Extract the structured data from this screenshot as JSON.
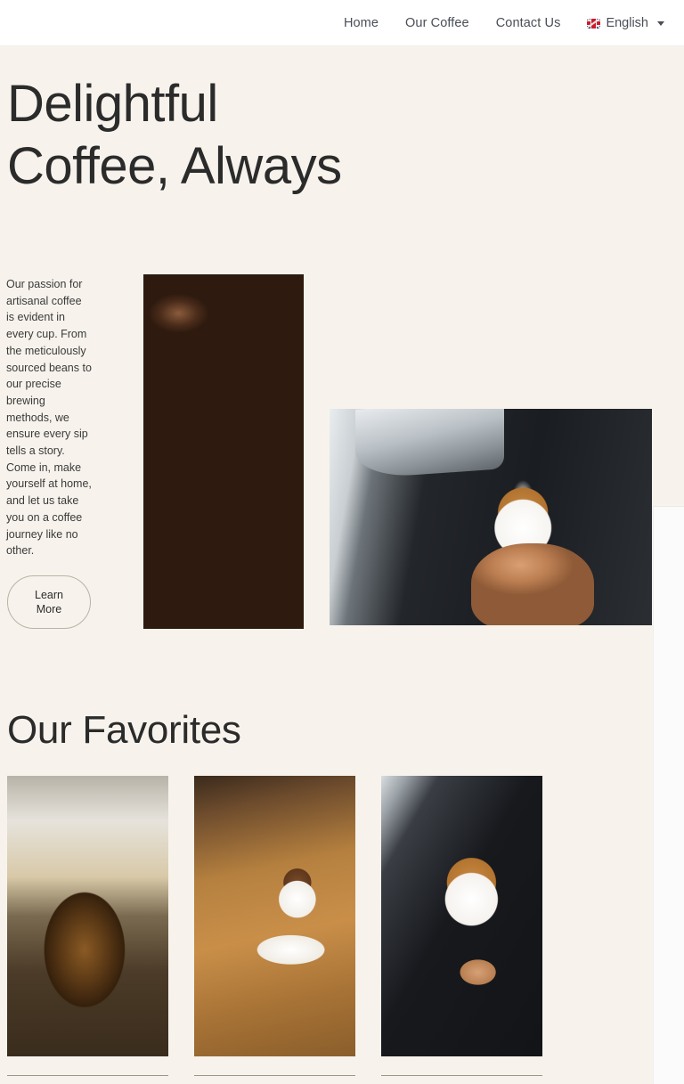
{
  "theme": {
    "page_background": "#F7F3EC",
    "header_background": "#FFFFFF",
    "text_dark": "#2B2B2B",
    "nav_text": "#4A4E57",
    "button_border": "#B9B2A6",
    "divider": "#9C958A"
  },
  "header": {
    "nav": [
      {
        "label": "Home",
        "name": "nav-link-home"
      },
      {
        "label": "Our Coffee",
        "name": "nav-link-our-coffee"
      },
      {
        "label": "Contact Us",
        "name": "nav-link-contact-us"
      }
    ],
    "language_switcher": {
      "flag_icon": "uk-flag-icon",
      "label": "English",
      "caret_icon": "chevron-down-icon"
    }
  },
  "hero": {
    "heading": "Delightful Coffee, Always",
    "paragraph": "Our passion for artisanal coffee is evident in every cup. From the meticulously sourced beans to our precise brewing methods, we ensure every sip tells a story. Come in, make yourself at home, and let us take you on a coffee journey like no other.",
    "cta_label": "Learn\nMore",
    "images": [
      {
        "name": "hero-image-coffee-beans",
        "alt": "Close-up of roasted coffee beans"
      },
      {
        "name": "hero-image-latte-pour",
        "alt": "Barista pouring milk into a latte cup"
      }
    ]
  },
  "favorites": {
    "heading": "Our Favorites",
    "cards": [
      {
        "name": "favorite-card-glass-coffee",
        "alt": "Glass mug of layered coffee on wooden table with open book"
      },
      {
        "name": "favorite-card-cappuccino-table",
        "alt": "Cappuccino cup and saucer on a wooden table"
      },
      {
        "name": "favorite-card-latte-art",
        "alt": "Hand holding a cup while milk is poured to form latte art"
      }
    ]
  }
}
